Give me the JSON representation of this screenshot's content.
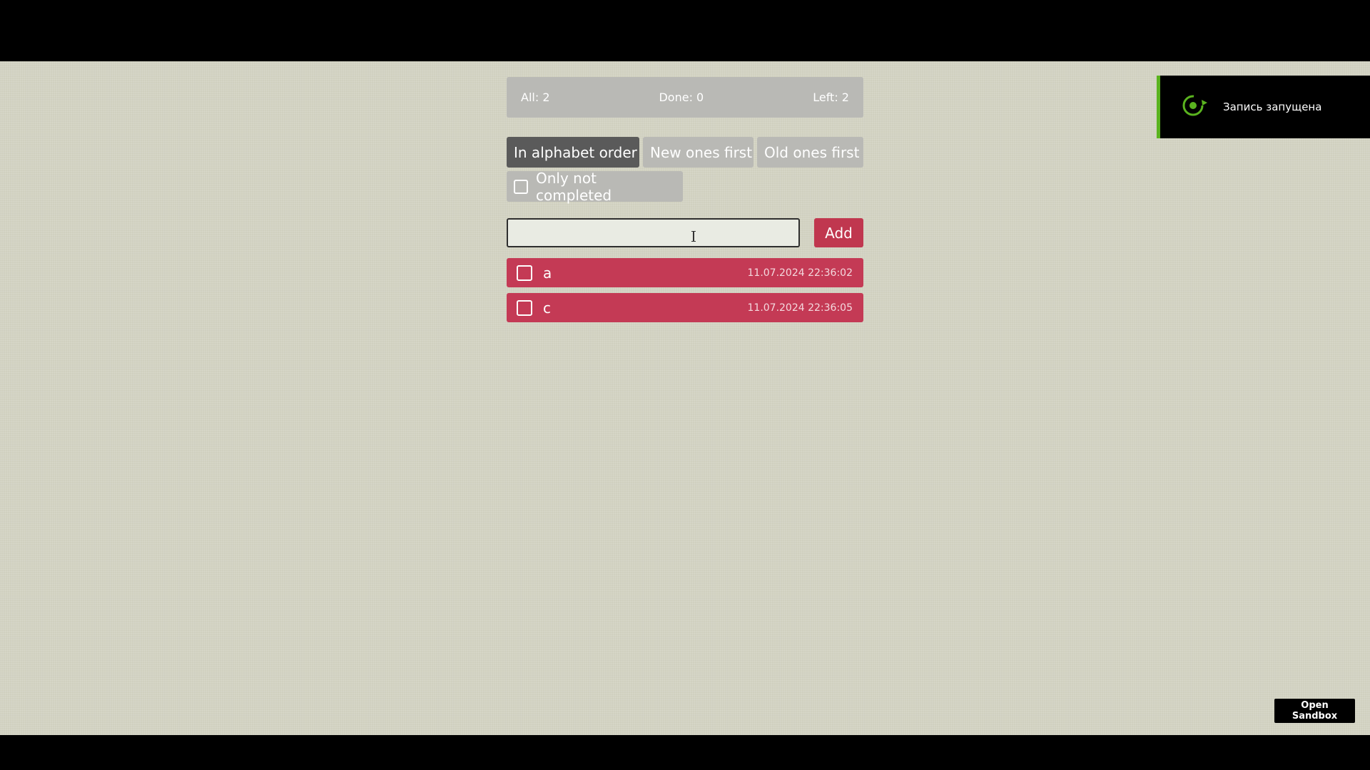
{
  "stats": {
    "all": "All: 2",
    "done": "Done: 0",
    "left": "Left: 2"
  },
  "sort_buttons": {
    "alphabet": "In alphabet order",
    "new_first": "New ones first",
    "old_first": "Old ones first",
    "active": "alphabet"
  },
  "filter": {
    "label": "Only not completed",
    "checked": false
  },
  "add_form": {
    "input_value": "",
    "button_label": "Add"
  },
  "tasks": [
    {
      "text": "a",
      "date": "11.07.2024 22:36:02",
      "done": false
    },
    {
      "text": "c",
      "date": "11.07.2024 22:36:05",
      "done": false
    }
  ],
  "notification": {
    "text": "Запись запущена",
    "icon": "record-icon",
    "accent": "#5ab31f"
  },
  "sandbox_button": "Open Sandbox",
  "colors": {
    "task": "#c43a55",
    "accent": "#c0374f",
    "active_sort": "#5a5a5a",
    "muted": "#b9b9b5"
  }
}
